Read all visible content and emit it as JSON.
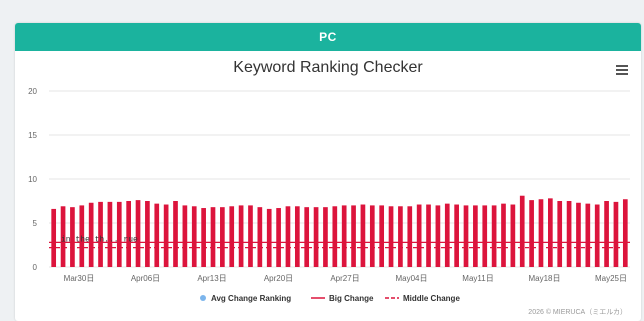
{
  "panel": {
    "header": "PC"
  },
  "chart_data": {
    "type": "bar",
    "title": "Keyword Ranking Checker",
    "ylim": [
      0,
      20
    ],
    "yticks": [
      0,
      5,
      10,
      15,
      20
    ],
    "x_tick_labels": [
      "Mar30日",
      "Apr06日",
      "Apr13日",
      "Apr20日",
      "Apr27日",
      "May04日",
      "May11日",
      "May18日",
      "May25日"
    ],
    "values": [
      6.6,
      6.9,
      6.8,
      7.0,
      7.3,
      7.4,
      7.4,
      7.4,
      7.5,
      7.6,
      7.5,
      7.2,
      7.1,
      7.5,
      7.0,
      6.9,
      6.7,
      6.8,
      6.8,
      6.9,
      7.0,
      7.0,
      6.8,
      6.6,
      6.7,
      6.9,
      6.9,
      6.8,
      6.8,
      6.8,
      6.9,
      7.0,
      7.0,
      7.1,
      7.0,
      7.0,
      6.9,
      6.9,
      6.9,
      7.1,
      7.1,
      7.0,
      7.2,
      7.1,
      7.0,
      7.0,
      7.0,
      7.0,
      7.2,
      7.1,
      8.1,
      7.6,
      7.7,
      7.8,
      7.5,
      7.5,
      7.3,
      7.2,
      7.1,
      7.5,
      7.4,
      7.7
    ],
    "series": [
      {
        "name": "Avg Change Ranking",
        "color": "#7cb5ec",
        "style": "marker"
      },
      {
        "name": "Big Change",
        "value": 2.8,
        "color": "#dc143c",
        "style": "solid"
      },
      {
        "name": "Middle Change",
        "value": 2.2,
        "color": "#dc143c",
        "style": "dashed"
      }
    ],
    "bar_color": "#dc143c",
    "grid": true,
    "legend_position": "bottom-center",
    "overlay_text": "in the th... rue"
  },
  "footer": {
    "copyright": "2026 © MIERUCA（ミエルカ）"
  }
}
